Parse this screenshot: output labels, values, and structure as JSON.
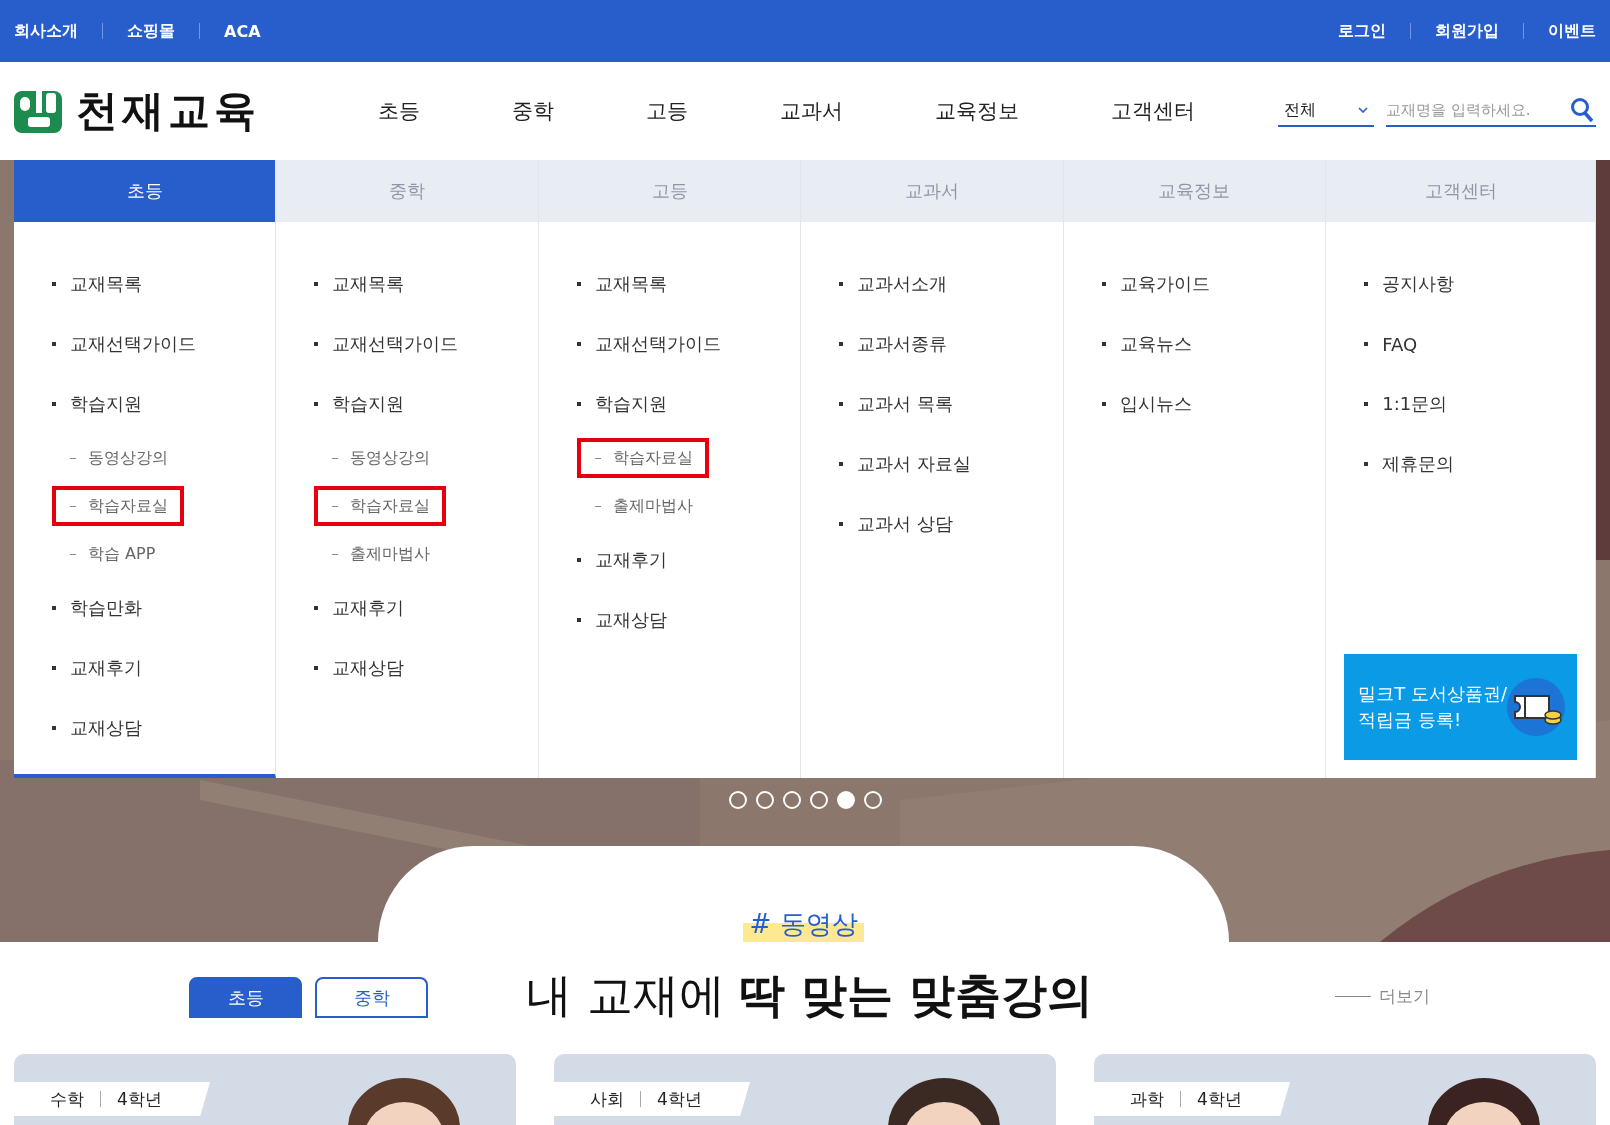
{
  "top_bar": {
    "left_links": [
      "회사소개",
      "쇼핑몰",
      "ACA"
    ],
    "right_links": [
      "로그인",
      "회원가입",
      "이벤트"
    ]
  },
  "header": {
    "logo_text": "천재교육",
    "nav": [
      "초등",
      "중학",
      "고등",
      "교과서",
      "교육정보",
      "고객센터"
    ],
    "search": {
      "scope": "전체",
      "placeholder": "교재명을 입력하세요."
    }
  },
  "mega_menu": {
    "columns": [
      {
        "label": "초등",
        "selected": true,
        "items": [
          {
            "text": "교재목록"
          },
          {
            "text": "교재선택가이드"
          },
          {
            "text": "학습지원",
            "children": [
              {
                "text": "동영상강의",
                "highlighted": false
              },
              {
                "text": "학습자료실",
                "highlighted": true
              },
              {
                "text": "학습 APP",
                "highlighted": false
              }
            ]
          },
          {
            "text": "학습만화"
          },
          {
            "text": "교재후기"
          },
          {
            "text": "교재상담"
          }
        ]
      },
      {
        "label": "중학",
        "selected": false,
        "items": [
          {
            "text": "교재목록"
          },
          {
            "text": "교재선택가이드"
          },
          {
            "text": "학습지원",
            "children": [
              {
                "text": "동영상강의",
                "highlighted": false
              },
              {
                "text": "학습자료실",
                "highlighted": true
              },
              {
                "text": "출제마법사",
                "highlighted": false
              }
            ]
          },
          {
            "text": "교재후기"
          },
          {
            "text": "교재상담"
          }
        ]
      },
      {
        "label": "고등",
        "selected": false,
        "items": [
          {
            "text": "교재목록"
          },
          {
            "text": "교재선택가이드"
          },
          {
            "text": "학습지원",
            "children": [
              {
                "text": "학습자료실",
                "highlighted": true
              },
              {
                "text": "출제마법사",
                "highlighted": false
              }
            ]
          },
          {
            "text": "교재후기"
          },
          {
            "text": "교재상담"
          }
        ]
      },
      {
        "label": "교과서",
        "selected": false,
        "items": [
          {
            "text": "교과서소개"
          },
          {
            "text": "교과서종류"
          },
          {
            "text": "교과서 목록"
          },
          {
            "text": "교과서 자료실"
          },
          {
            "text": "교과서 상담"
          }
        ]
      },
      {
        "label": "교육정보",
        "selected": false,
        "items": [
          {
            "text": "교육가이드"
          },
          {
            "text": "교육뉴스"
          },
          {
            "text": "입시뉴스"
          }
        ]
      },
      {
        "label": "고객센터",
        "selected": false,
        "items": [
          {
            "text": "공지사항"
          },
          {
            "text": "FAQ"
          },
          {
            "text": "1:1문의"
          },
          {
            "text": "제휴문의"
          }
        ],
        "banner": {
          "lines": [
            "밀크T 도서상품권/",
            "적립금 등록!"
          ]
        }
      }
    ]
  },
  "carousel_dots": [
    {
      "selected": false
    },
    {
      "selected": false
    },
    {
      "selected": false
    },
    {
      "selected": false
    },
    {
      "selected": true
    },
    {
      "selected": false
    }
  ],
  "video_section": {
    "tag": "# 동영상",
    "title": "내 교재에 **딱 맞는 맞춤강의**",
    "more": "더보기",
    "tabs": [
      {
        "label": "초등",
        "selected": true
      },
      {
        "label": "중학",
        "selected": false
      }
    ],
    "cards": [
      {
        "subject": "수학",
        "grade": "4학년"
      },
      {
        "subject": "사회",
        "grade": "4학년"
      },
      {
        "subject": "과학",
        "grade": "4학년"
      }
    ]
  }
}
